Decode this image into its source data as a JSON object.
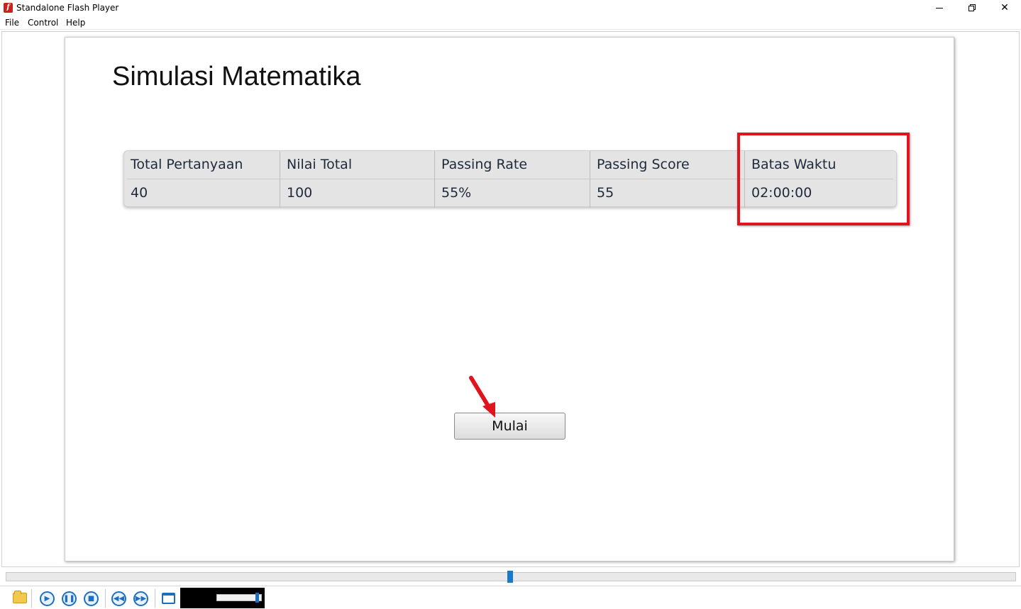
{
  "window": {
    "title": "Standalone Flash Player",
    "controls": [
      "minimize",
      "restore",
      "close"
    ]
  },
  "menu": {
    "file": "File",
    "control": "Control",
    "help": "Help"
  },
  "page": {
    "title": "Simulasi Matematika"
  },
  "info_table": {
    "columns": [
      {
        "header": "Total Pertanyaan",
        "value": "40"
      },
      {
        "header": "Nilai Total",
        "value": "100"
      },
      {
        "header": "Passing Rate",
        "value": "55%"
      },
      {
        "header": "Passing Score",
        "value": "55"
      },
      {
        "header": "Batas Waktu",
        "value": "02:00:00"
      }
    ]
  },
  "buttons": {
    "start_label": "Mulai"
  },
  "annotation": {
    "highlight_color": "#e0141c",
    "arrow_color": "#e0141c"
  },
  "player": {
    "timeline_position": 0.5,
    "volume_level": 0.9,
    "accent_color": "#1c6fc0"
  }
}
